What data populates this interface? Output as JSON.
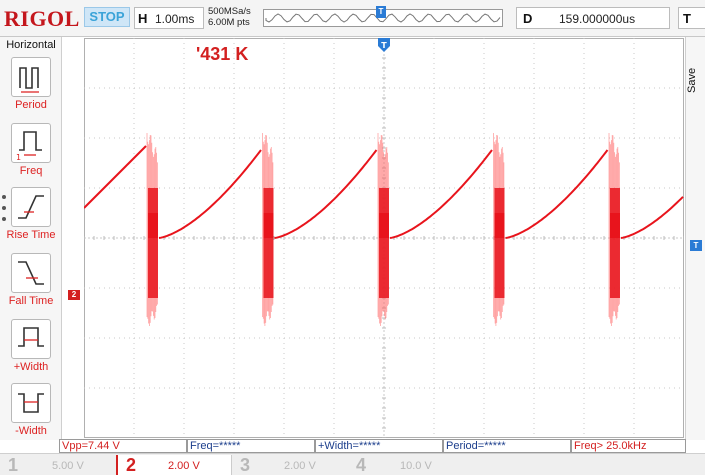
{
  "brand": "RIGOL",
  "run_status": "STOP",
  "horizontal": {
    "letter": "H",
    "scale": "1.00ms"
  },
  "acquisition": {
    "sample_rate": "500MSa/s",
    "memory_depth": "6.00M pts"
  },
  "delay": {
    "letter": "D",
    "value": "159.000000us"
  },
  "trigger": {
    "letter": "T",
    "marker": "T"
  },
  "sidebar": {
    "title": "Horizontal",
    "items": [
      {
        "label": "Period",
        "icon": "period-icon"
      },
      {
        "label": "Freq",
        "icon": "frequency-icon"
      },
      {
        "label": "Rise Time",
        "icon": "rise-time-icon"
      },
      {
        "label": "Fall Time",
        "icon": "fall-time-icon"
      },
      {
        "label": "+Width",
        "icon": "positive-width-icon"
      },
      {
        "label": "-Width",
        "icon": "negative-width-icon"
      }
    ]
  },
  "right_panel": {
    "save_label": "Save"
  },
  "annotation": "'431 K",
  "channel_marker": "2",
  "measurements": [
    {
      "text": "Vpp=7.44 V",
      "color": "#d32020"
    },
    {
      "text": "Freq=*****",
      "color": "#1c3e8c"
    },
    {
      "text": "+Width=*****",
      "color": "#1c3e8c"
    },
    {
      "text": "Period=*****",
      "color": "#1c3e8c"
    },
    {
      "text": "Freq> 25.0kHz",
      "color": "#d32020"
    }
  ],
  "channels": [
    {
      "num": "1",
      "value": "5.00 V",
      "active": false,
      "color": "#b8b8b8"
    },
    {
      "num": "2",
      "value": "2.00 V",
      "active": true,
      "color": "#d32020"
    },
    {
      "num": "3",
      "value": "2.00 V",
      "active": false,
      "color": "#b8b8b8"
    },
    {
      "num": "4",
      "value": "10.0 V",
      "active": false,
      "color": "#b8b8b8"
    }
  ],
  "colors": {
    "trace": "#e8141c",
    "grid": "#c8c8c8",
    "accent": "#2a7bd5",
    "brand": "#c4161c"
  }
}
